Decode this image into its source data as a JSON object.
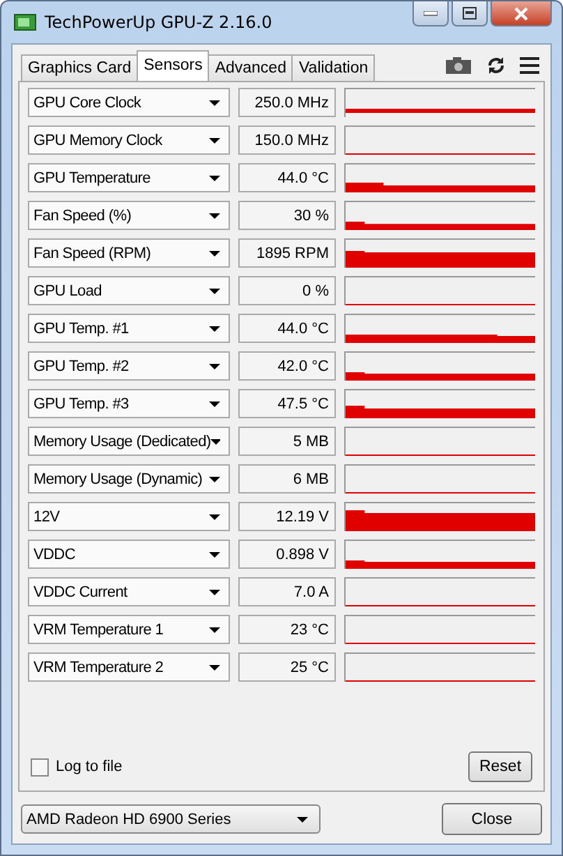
{
  "window": {
    "title": "TechPowerUp GPU-Z 2.16.0"
  },
  "tabs": [
    {
      "label": "Graphics Card",
      "selected": false
    },
    {
      "label": "Sensors",
      "selected": true
    },
    {
      "label": "Advanced",
      "selected": false
    },
    {
      "label": "Validation",
      "selected": false
    }
  ],
  "sensors": [
    {
      "name": "GPU Core Clock",
      "value": "250.0 MHz"
    },
    {
      "name": "GPU Memory Clock",
      "value": "150.0 MHz"
    },
    {
      "name": "GPU Temperature",
      "value": "44.0 °C"
    },
    {
      "name": "Fan Speed (%)",
      "value": "30 %"
    },
    {
      "name": "Fan Speed (RPM)",
      "value": "1895 RPM"
    },
    {
      "name": "GPU Load",
      "value": "0 %"
    },
    {
      "name": "GPU Temp. #1",
      "value": "44.0 °C"
    },
    {
      "name": "GPU Temp. #2",
      "value": "42.0 °C"
    },
    {
      "name": "GPU Temp. #3",
      "value": "47.5 °C"
    },
    {
      "name": "Memory Usage (Dedicated)",
      "value": "5 MB"
    },
    {
      "name": "Memory Usage (Dynamic)",
      "value": "6 MB"
    },
    {
      "name": "12V",
      "value": "12.19 V"
    },
    {
      "name": "VDDC",
      "value": "0.898 V"
    },
    {
      "name": "VDDC Current",
      "value": "7.0 A"
    },
    {
      "name": "VRM Temperature 1",
      "value": "23 °C"
    },
    {
      "name": "VRM Temperature 2",
      "value": "25 °C"
    }
  ],
  "log_to_file": {
    "label": "Log to file",
    "checked": false
  },
  "reset_button": "Reset",
  "gpu_select": "AMD Radeon HD 6900 Series",
  "close_button": "Close"
}
